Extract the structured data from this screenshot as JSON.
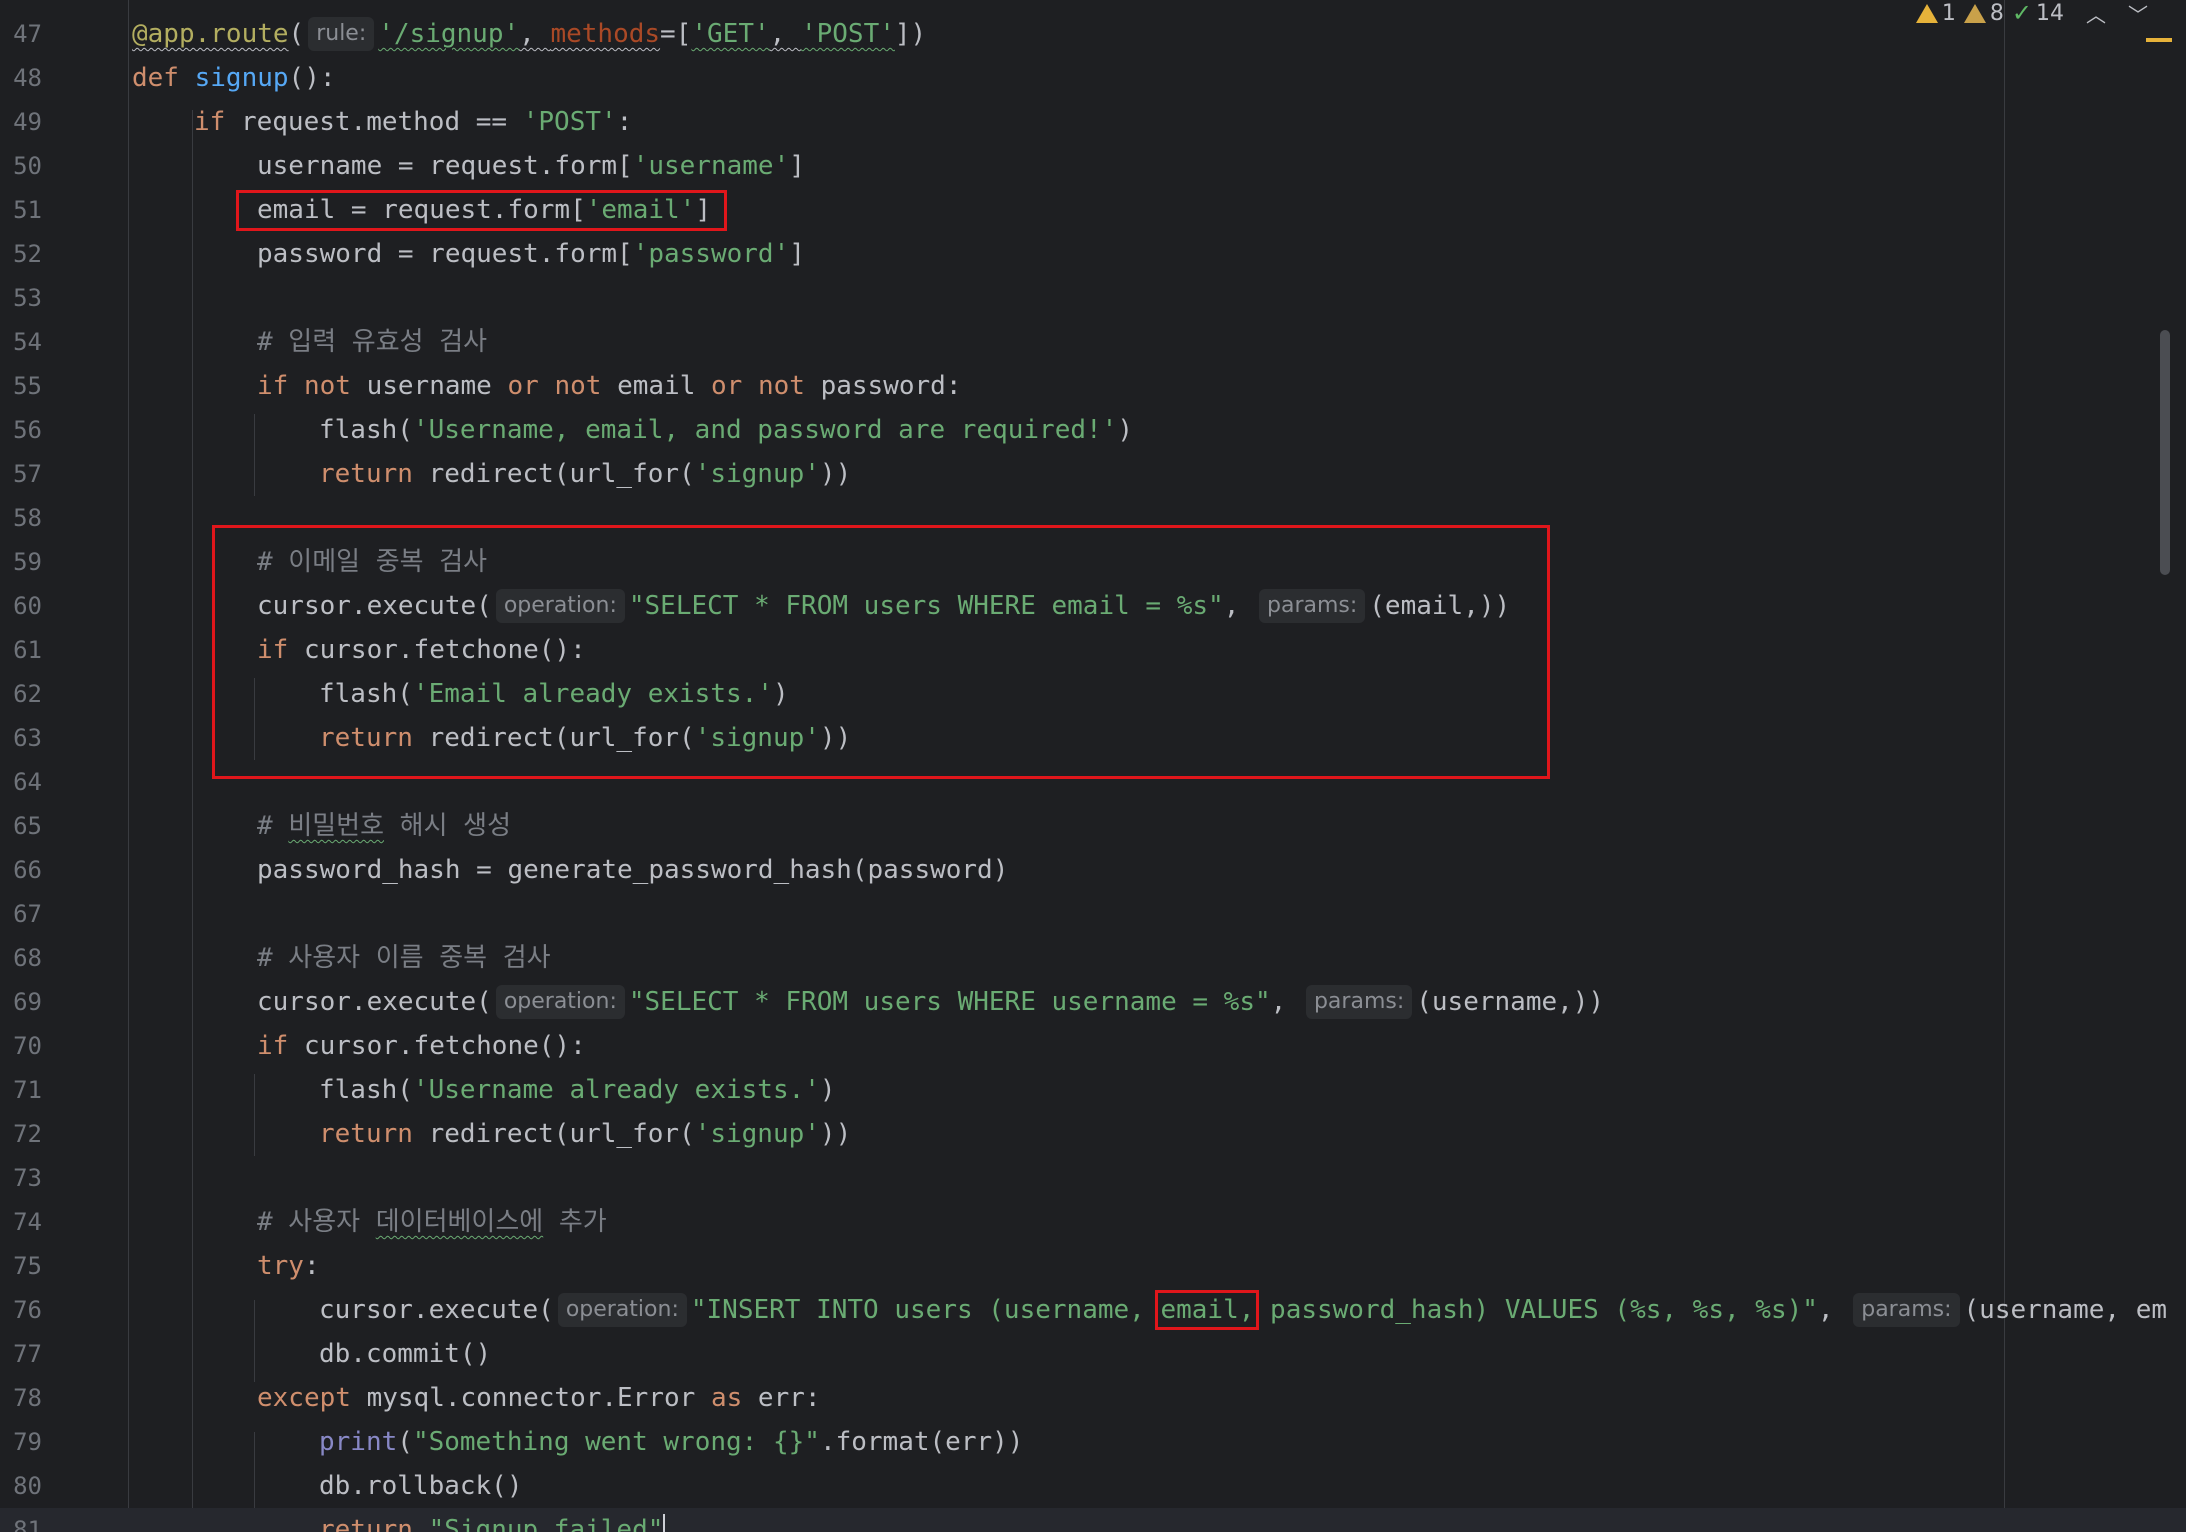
{
  "status_bar": {
    "errors_count": "1",
    "warnings_count": "8",
    "ok_count": "14"
  },
  "hints": {
    "rule": "rule:",
    "methods": "methods",
    "operation": "operation:",
    "params": "params:"
  },
  "lines": [
    {
      "n": "47"
    },
    {
      "n": "48"
    },
    {
      "n": "49"
    },
    {
      "n": "50"
    },
    {
      "n": "51"
    },
    {
      "n": "52"
    },
    {
      "n": "53"
    },
    {
      "n": "54"
    },
    {
      "n": "55"
    },
    {
      "n": "56"
    },
    {
      "n": "57"
    },
    {
      "n": "58"
    },
    {
      "n": "59"
    },
    {
      "n": "60"
    },
    {
      "n": "61"
    },
    {
      "n": "62"
    },
    {
      "n": "63"
    },
    {
      "n": "64"
    },
    {
      "n": "65"
    },
    {
      "n": "66"
    },
    {
      "n": "67"
    },
    {
      "n": "68"
    },
    {
      "n": "69"
    },
    {
      "n": "70"
    },
    {
      "n": "71"
    },
    {
      "n": "72"
    },
    {
      "n": "73"
    },
    {
      "n": "74"
    },
    {
      "n": "75"
    },
    {
      "n": "76"
    },
    {
      "n": "77"
    },
    {
      "n": "78"
    },
    {
      "n": "79"
    },
    {
      "n": "80"
    },
    {
      "n": "81"
    }
  ],
  "code": {
    "l47": {
      "deco": "@app.route",
      "open": "(",
      "str1": "'/signup'",
      "comma": ", ",
      "eq": "=[",
      "s_get": "'GET'",
      "c2": ", ",
      "s_post": "'POST'",
      "close": "])"
    },
    "l48": {
      "kw": "def ",
      "fn": "signup",
      "rest": "():"
    },
    "l49": {
      "kw": "if ",
      "rest": "request.method == ",
      "str": "'POST'",
      "end": ":"
    },
    "l50": {
      "rest": "username = request.form[",
      "str": "'username'",
      "end": "]"
    },
    "l51": {
      "rest": "email = request.form[",
      "str": "'email'",
      "end": "]"
    },
    "l52": {
      "rest": "password = request.form[",
      "str": "'password'",
      "end": "]"
    },
    "l54": {
      "cmt": "# 입력 유효성 검사"
    },
    "l55": {
      "kw1": "if ",
      "kw2": "not ",
      "v1": "username ",
      "kw3": "or ",
      "kw4": "not ",
      "v2": "email ",
      "kw5": "or ",
      "kw6": "not ",
      "v3": "password:"
    },
    "l56": {
      "rest": "flash(",
      "str": "'Username, email, and password are required!'",
      "end": ")"
    },
    "l57": {
      "kw": "return ",
      "rest": "redirect(url_for(",
      "str": "'signup'",
      "end": "))"
    },
    "l59": {
      "cmt": "# 이메일 중복 검사"
    },
    "l60": {
      "rest": "cursor.execute(",
      "str": "\"SELECT * FROM users WHERE email = %s\"",
      "comma": ", ",
      "end": "(email,))"
    },
    "l61": {
      "kw": "if ",
      "rest": "cursor.fetchone():"
    },
    "l62": {
      "rest": "flash(",
      "str": "'Email already exists.'",
      "end": ")"
    },
    "l63": {
      "kw": "return ",
      "rest": "redirect(url_for(",
      "str": "'signup'",
      "end": "))"
    },
    "l65": {
      "cmt1": "# ",
      "cmt_wavy": "비밀번호",
      "cmt2": " 해시 생성"
    },
    "l66": {
      "rest": "password_hash = generate_password_hash(password)"
    },
    "l68": {
      "cmt": "# 사용자 이름 중복 검사"
    },
    "l69": {
      "rest": "cursor.execute(",
      "str": "\"SELECT * FROM users WHERE username = %s\"",
      "comma": ", ",
      "end": "(username,))"
    },
    "l70": {
      "kw": "if ",
      "rest": "cursor.fetchone():"
    },
    "l71": {
      "rest": "flash(",
      "str": "'Username already exists.'",
      "end": ")"
    },
    "l72": {
      "kw": "return ",
      "rest": "redirect(url_for(",
      "str": "'signup'",
      "end": "))"
    },
    "l74": {
      "cmt1": "# 사용자 ",
      "cmt_wavy": "데이터베이스에",
      "cmt2": " 추가"
    },
    "l75": {
      "kw": "try",
      "end": ":"
    },
    "l76": {
      "rest": "cursor.execute(",
      "str1": "\"INSERT INTO users (username, ",
      "str_box": "email,",
      "str2": " password_hash) VALUES (%s, %s, %s)\"",
      "comma": ", ",
      "end": "(username, em"
    },
    "l77": {
      "rest": "db.commit()"
    },
    "l78": {
      "kw1": "except ",
      "rest": "mysql.connector.Error ",
      "kw2": "as ",
      "end": "err:"
    },
    "l79": {
      "bi": "print",
      "open": "(",
      "str": "\"Something went wrong: {}\"",
      "end": ".format(err))"
    },
    "l80": {
      "rest": "db.rollback()"
    },
    "l81": {
      "kw": "return ",
      "str": "\"Signup failed\""
    }
  }
}
